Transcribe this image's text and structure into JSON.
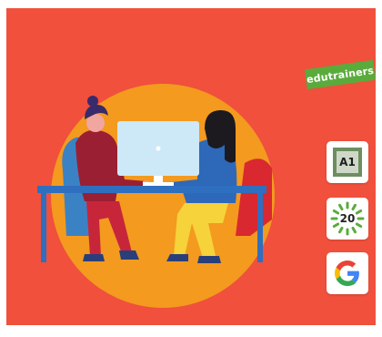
{
  "brand": {
    "name": "edutrainers",
    "color": "#5aab3c"
  },
  "badges": [
    {
      "label": "A1",
      "icon": "a1-certificate-icon"
    },
    {
      "label": "20",
      "icon": "twenty-years-icon"
    },
    {
      "label": "",
      "icon": "google-icon"
    }
  ],
  "colors": {
    "background": "#f0503c",
    "circle": "#f39a1f",
    "desk": "#2f6fc0",
    "monitor": "#cde9f7"
  }
}
